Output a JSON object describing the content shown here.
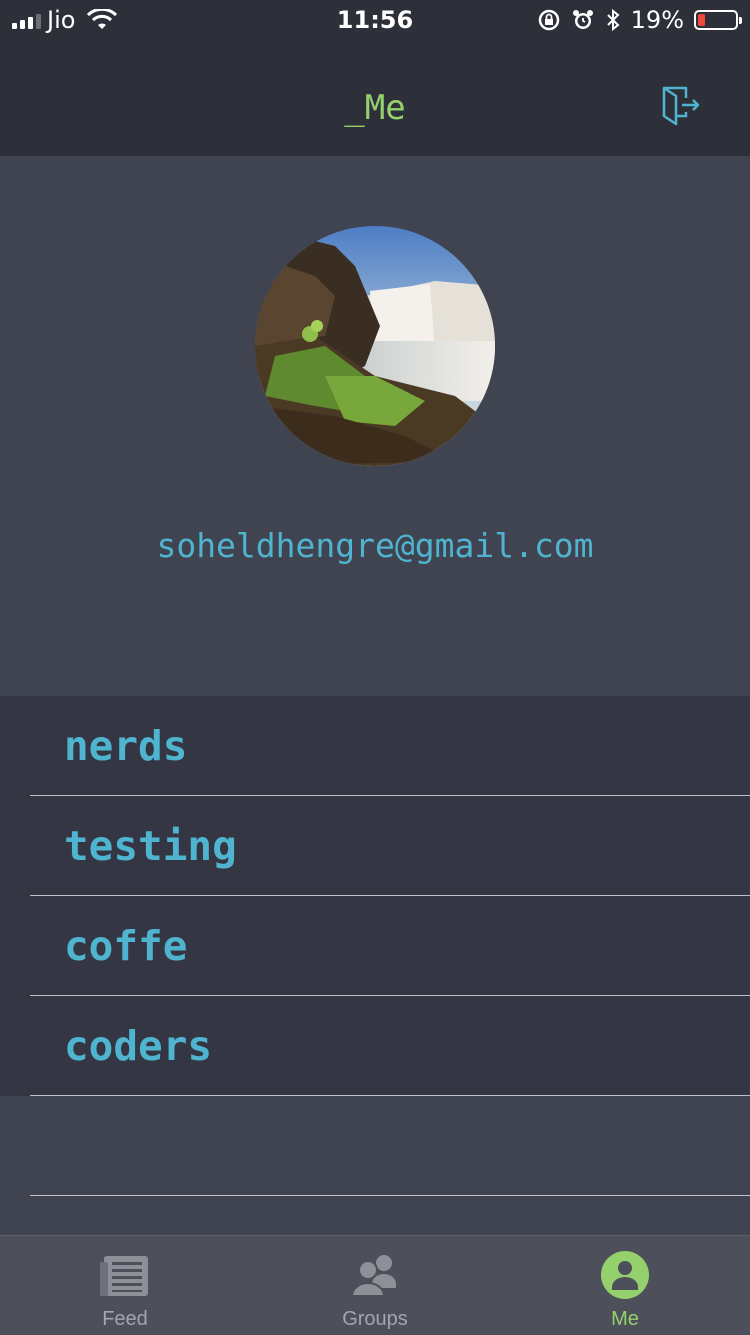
{
  "status_bar": {
    "carrier": "Jio",
    "time": "11:56",
    "battery_percent": "19%",
    "battery_level": 0.19,
    "icons": [
      "signal-icon",
      "wifi-icon",
      "rotation-lock-icon",
      "alarm-icon",
      "bluetooth-icon",
      "battery-icon"
    ]
  },
  "nav": {
    "title": "_Me",
    "logout_icon": "logout-icon"
  },
  "profile": {
    "email": "soheldhengre@gmail.com",
    "avatar": "waterfall-landscape-photo"
  },
  "groups": [
    {
      "label": "nerds"
    },
    {
      "label": "testing"
    },
    {
      "label": "coffe"
    },
    {
      "label": "coders"
    }
  ],
  "tabs": [
    {
      "label": "Feed",
      "icon": "feed-icon",
      "active": false
    },
    {
      "label": "Groups",
      "icon": "groups-icon",
      "active": false
    },
    {
      "label": "Me",
      "icon": "profile-icon",
      "active": true
    }
  ],
  "colors": {
    "accent_green": "#94d16c",
    "accent_cyan": "#4fb4cf",
    "bar_dark": "#2d3039",
    "background": "#404350",
    "list_background": "#343743",
    "battery_red": "#f04a3f"
  }
}
